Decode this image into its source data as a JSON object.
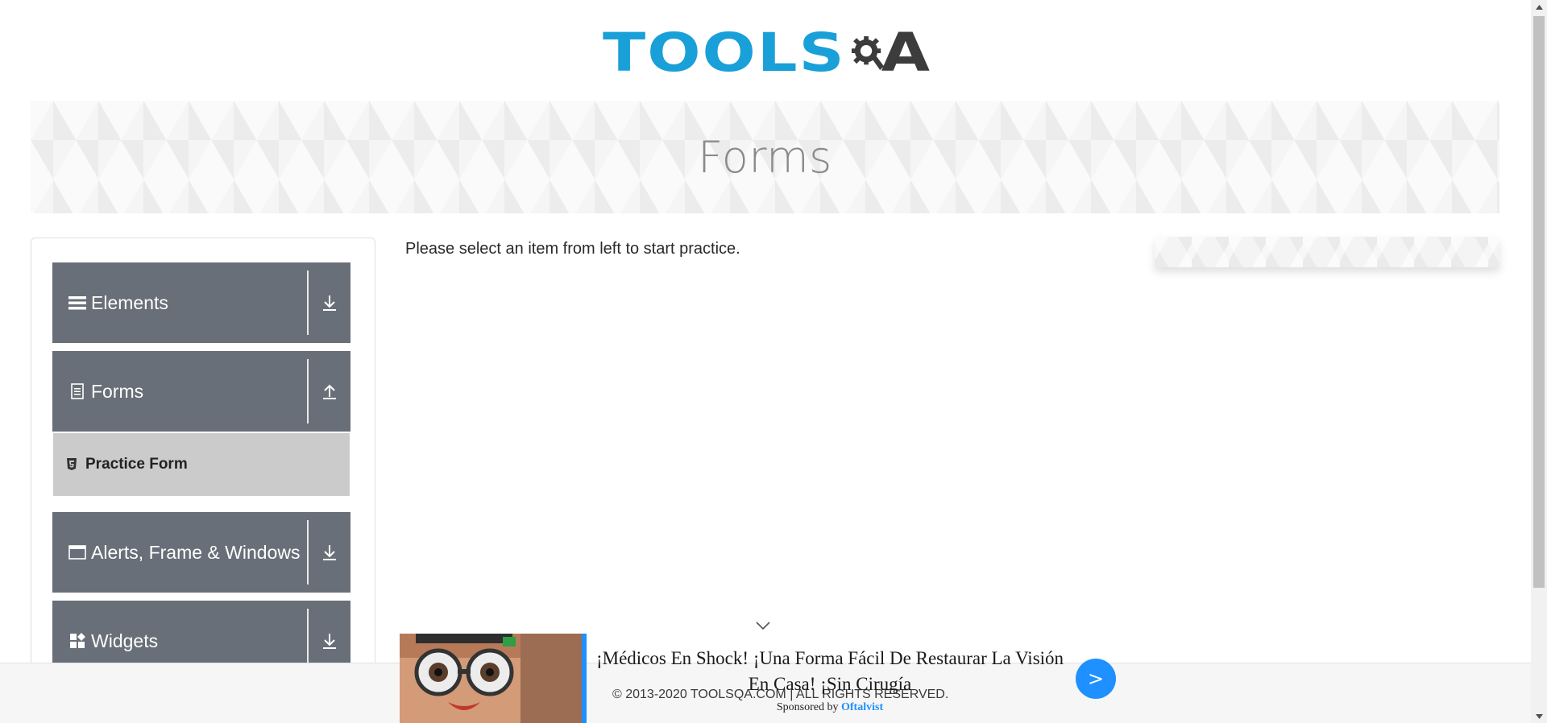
{
  "logo": {
    "part1": "TOOLS",
    "part2": "A"
  },
  "banner": {
    "title": "Forms"
  },
  "sidebar": {
    "groups": [
      {
        "label": "Elements",
        "icon": "hamburger-icon",
        "state": "collapsed"
      },
      {
        "label": "Forms",
        "icon": "document-icon",
        "state": "expanded"
      },
      {
        "label": "Alerts, Frame & Windows",
        "icon": "window-icon",
        "state": "collapsed"
      },
      {
        "label": "Widgets",
        "icon": "widgets-icon",
        "state": "collapsed"
      }
    ],
    "sub_items": [
      {
        "label": "Practice Form",
        "icon": "html5-icon",
        "selected": true
      }
    ]
  },
  "main": {
    "instruction": "Please select an item from left to start practice."
  },
  "ad": {
    "headline": "¡Médicos En Shock! ¡Una Forma Fácil De Restaurar La Visión En Casa! ¡Sin Cirugía",
    "sponsored_by": "Sponsored by",
    "sponsor": "Oftalvist",
    "go_label": ">",
    "accent": "#1e90ff"
  },
  "footer": {
    "text": "© 2013-2020 TOOLSQA.COM | ALL RIGHTS RESERVED."
  },
  "colors": {
    "brand_blue": "#1aa0d8",
    "brand_dark": "#3c3c3c",
    "sidebar_group_bg": "#686f78",
    "selected_item_bg": "#cbcbcb"
  }
}
